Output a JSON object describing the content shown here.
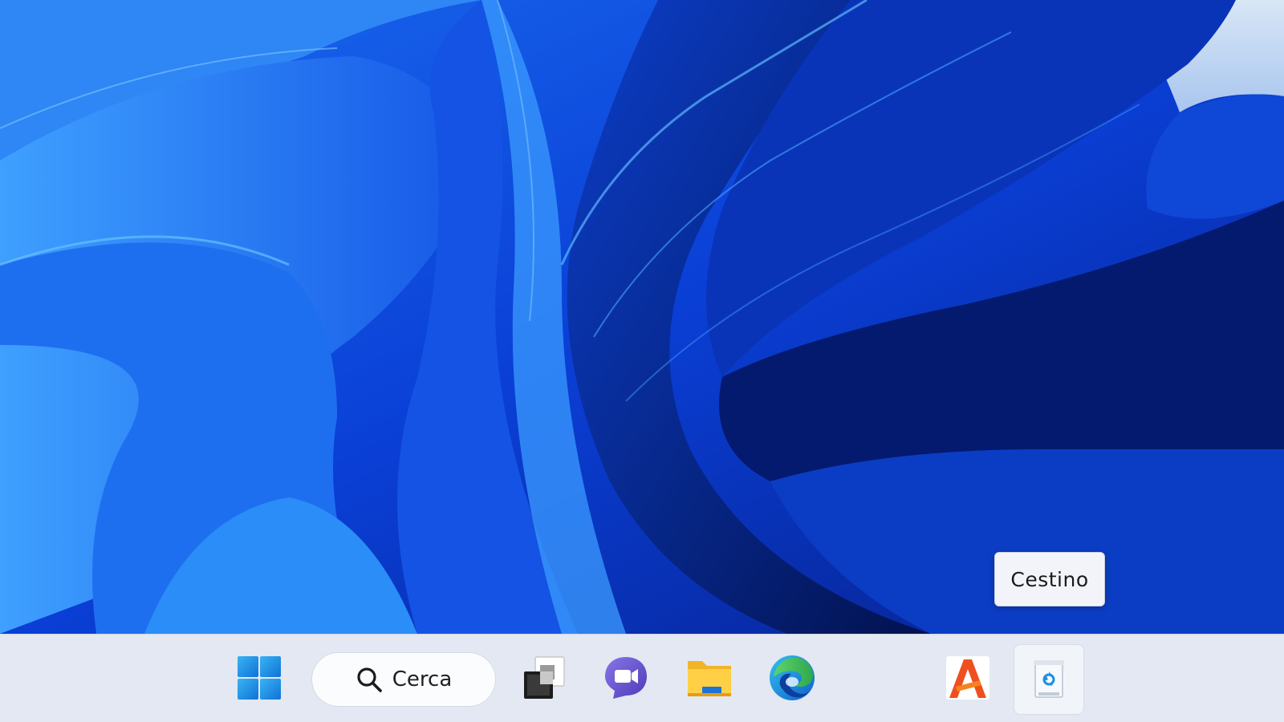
{
  "desktop": {
    "tooltip_text": "Cestino"
  },
  "taskbar": {
    "search_label": "Cerca",
    "items": [
      {
        "name": "start",
        "icon": "windows-logo-icon"
      },
      {
        "name": "search",
        "icon": "search-icon"
      },
      {
        "name": "task-view",
        "icon": "task-view-icon"
      },
      {
        "name": "teams-chat",
        "icon": "teams-video-icon"
      },
      {
        "name": "file-explorer",
        "icon": "folder-icon"
      },
      {
        "name": "edge",
        "icon": "edge-browser-icon"
      },
      {
        "name": "app-a",
        "icon": "orange-a-app-icon"
      },
      {
        "name": "recycle-bin",
        "icon": "recycle-bin-icon",
        "active": true
      }
    ]
  },
  "colors": {
    "taskbar_bg": "#e3e8f3",
    "wallpaper_primary": "#0a3fd6",
    "accent_blue": "#1a8ce8",
    "tooltip_bg": "#f3f4fa"
  }
}
